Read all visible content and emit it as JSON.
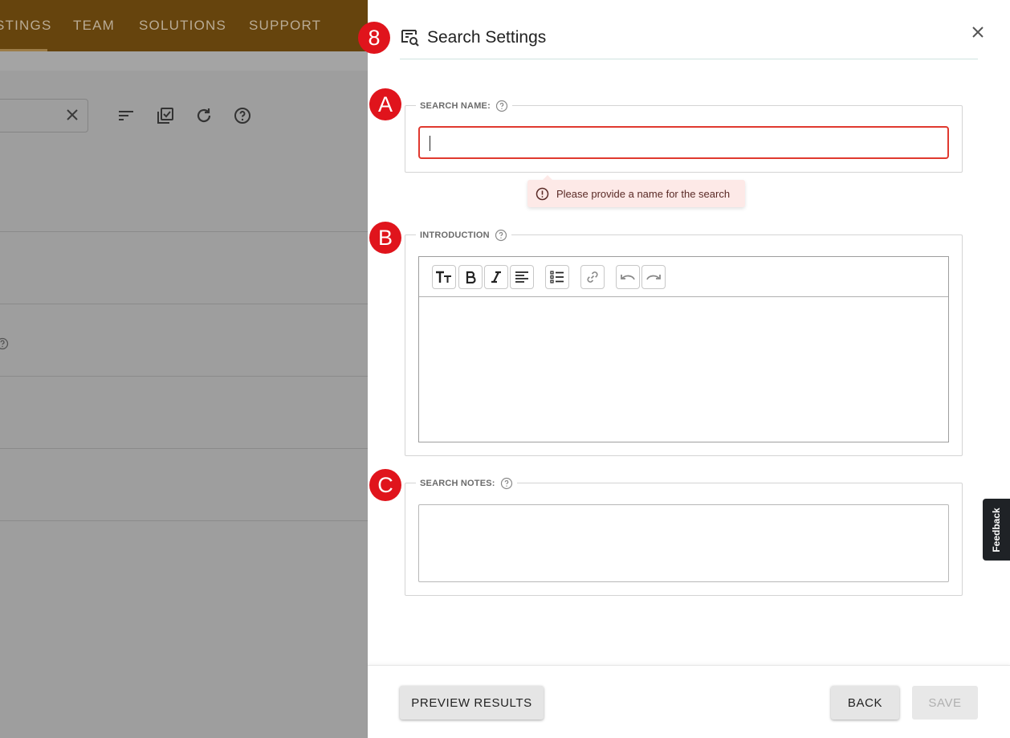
{
  "nav": {
    "items": [
      "STINGS",
      "TEAM",
      "SOLUTIONS",
      "SUPPORT"
    ]
  },
  "panel": {
    "title": "Search Settings",
    "badges": {
      "step": "8",
      "name": "A",
      "intro": "B",
      "notes": "C"
    },
    "search_name": {
      "label": "SEARCH NAME:",
      "value": "",
      "error": "Please provide a name for the search"
    },
    "introduction": {
      "label": "INTRODUCTION",
      "toolbar": [
        "text-size-icon",
        "bold-icon",
        "italic-icon",
        "align-left-icon",
        "bulleted-list-icon",
        "link-icon",
        "undo-icon",
        "redo-icon"
      ],
      "content": ""
    },
    "search_notes": {
      "label": "SEARCH NOTES:",
      "value": ""
    },
    "footer": {
      "preview_label": "PREVIEW RESULTS",
      "back_label": "BACK",
      "save_label": "SAVE"
    }
  },
  "feedback": {
    "label": "Feedback"
  },
  "colors": {
    "nav_bg": "#66440d",
    "error_border": "#e0392f",
    "error_bg": "#fde9e7",
    "badge": "#e0141c"
  }
}
